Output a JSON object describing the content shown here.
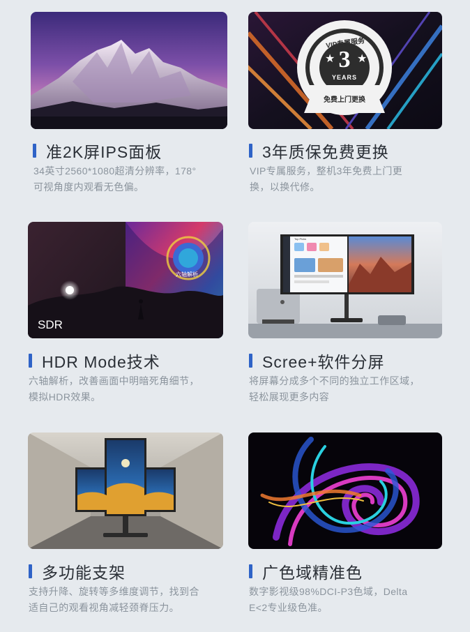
{
  "features": [
    {
      "title": "准2K屏IPS面板",
      "desc": [
        "34英寸2560*1080超清分辨率，178°",
        "可视角度内观看无色偏。"
      ]
    },
    {
      "title": "3年质保免费更换",
      "desc": [
        "VIP专属服务，整机3年免费上门更",
        "换，以换代修。"
      ],
      "badge": {
        "top": "VIP专属服务",
        "number": "3",
        "unit": "YEARS",
        "bottom": "免费上门更换"
      }
    },
    {
      "title": "HDR Mode技术",
      "desc": [
        "六轴解析，改善画面中明暗死角细节，",
        "模拟HDR效果。"
      ],
      "overlay_left": "SDR",
      "overlay_logo": "六轴解析"
    },
    {
      "title": "Scree+软件分屏",
      "desc": [
        "将屏幕分成多个不同的独立工作区域，",
        "轻松展现更多内容"
      ],
      "screen_label": "Top Picks"
    },
    {
      "title": "多功能支架",
      "desc": [
        "支持升降、旋转等多维度调节，找到合",
        "适自己的观看视角减轻颈脊压力。"
      ]
    },
    {
      "title": "广色域精准色",
      "desc": [
        "数字影视级98%DCI-P3色域，Delta",
        "E<2专业级色准。"
      ]
    }
  ],
  "colors": {
    "accent": "#2f63c7",
    "background": "#e6eaee",
    "title": "#2a2f36",
    "desc": "#8b949d"
  }
}
